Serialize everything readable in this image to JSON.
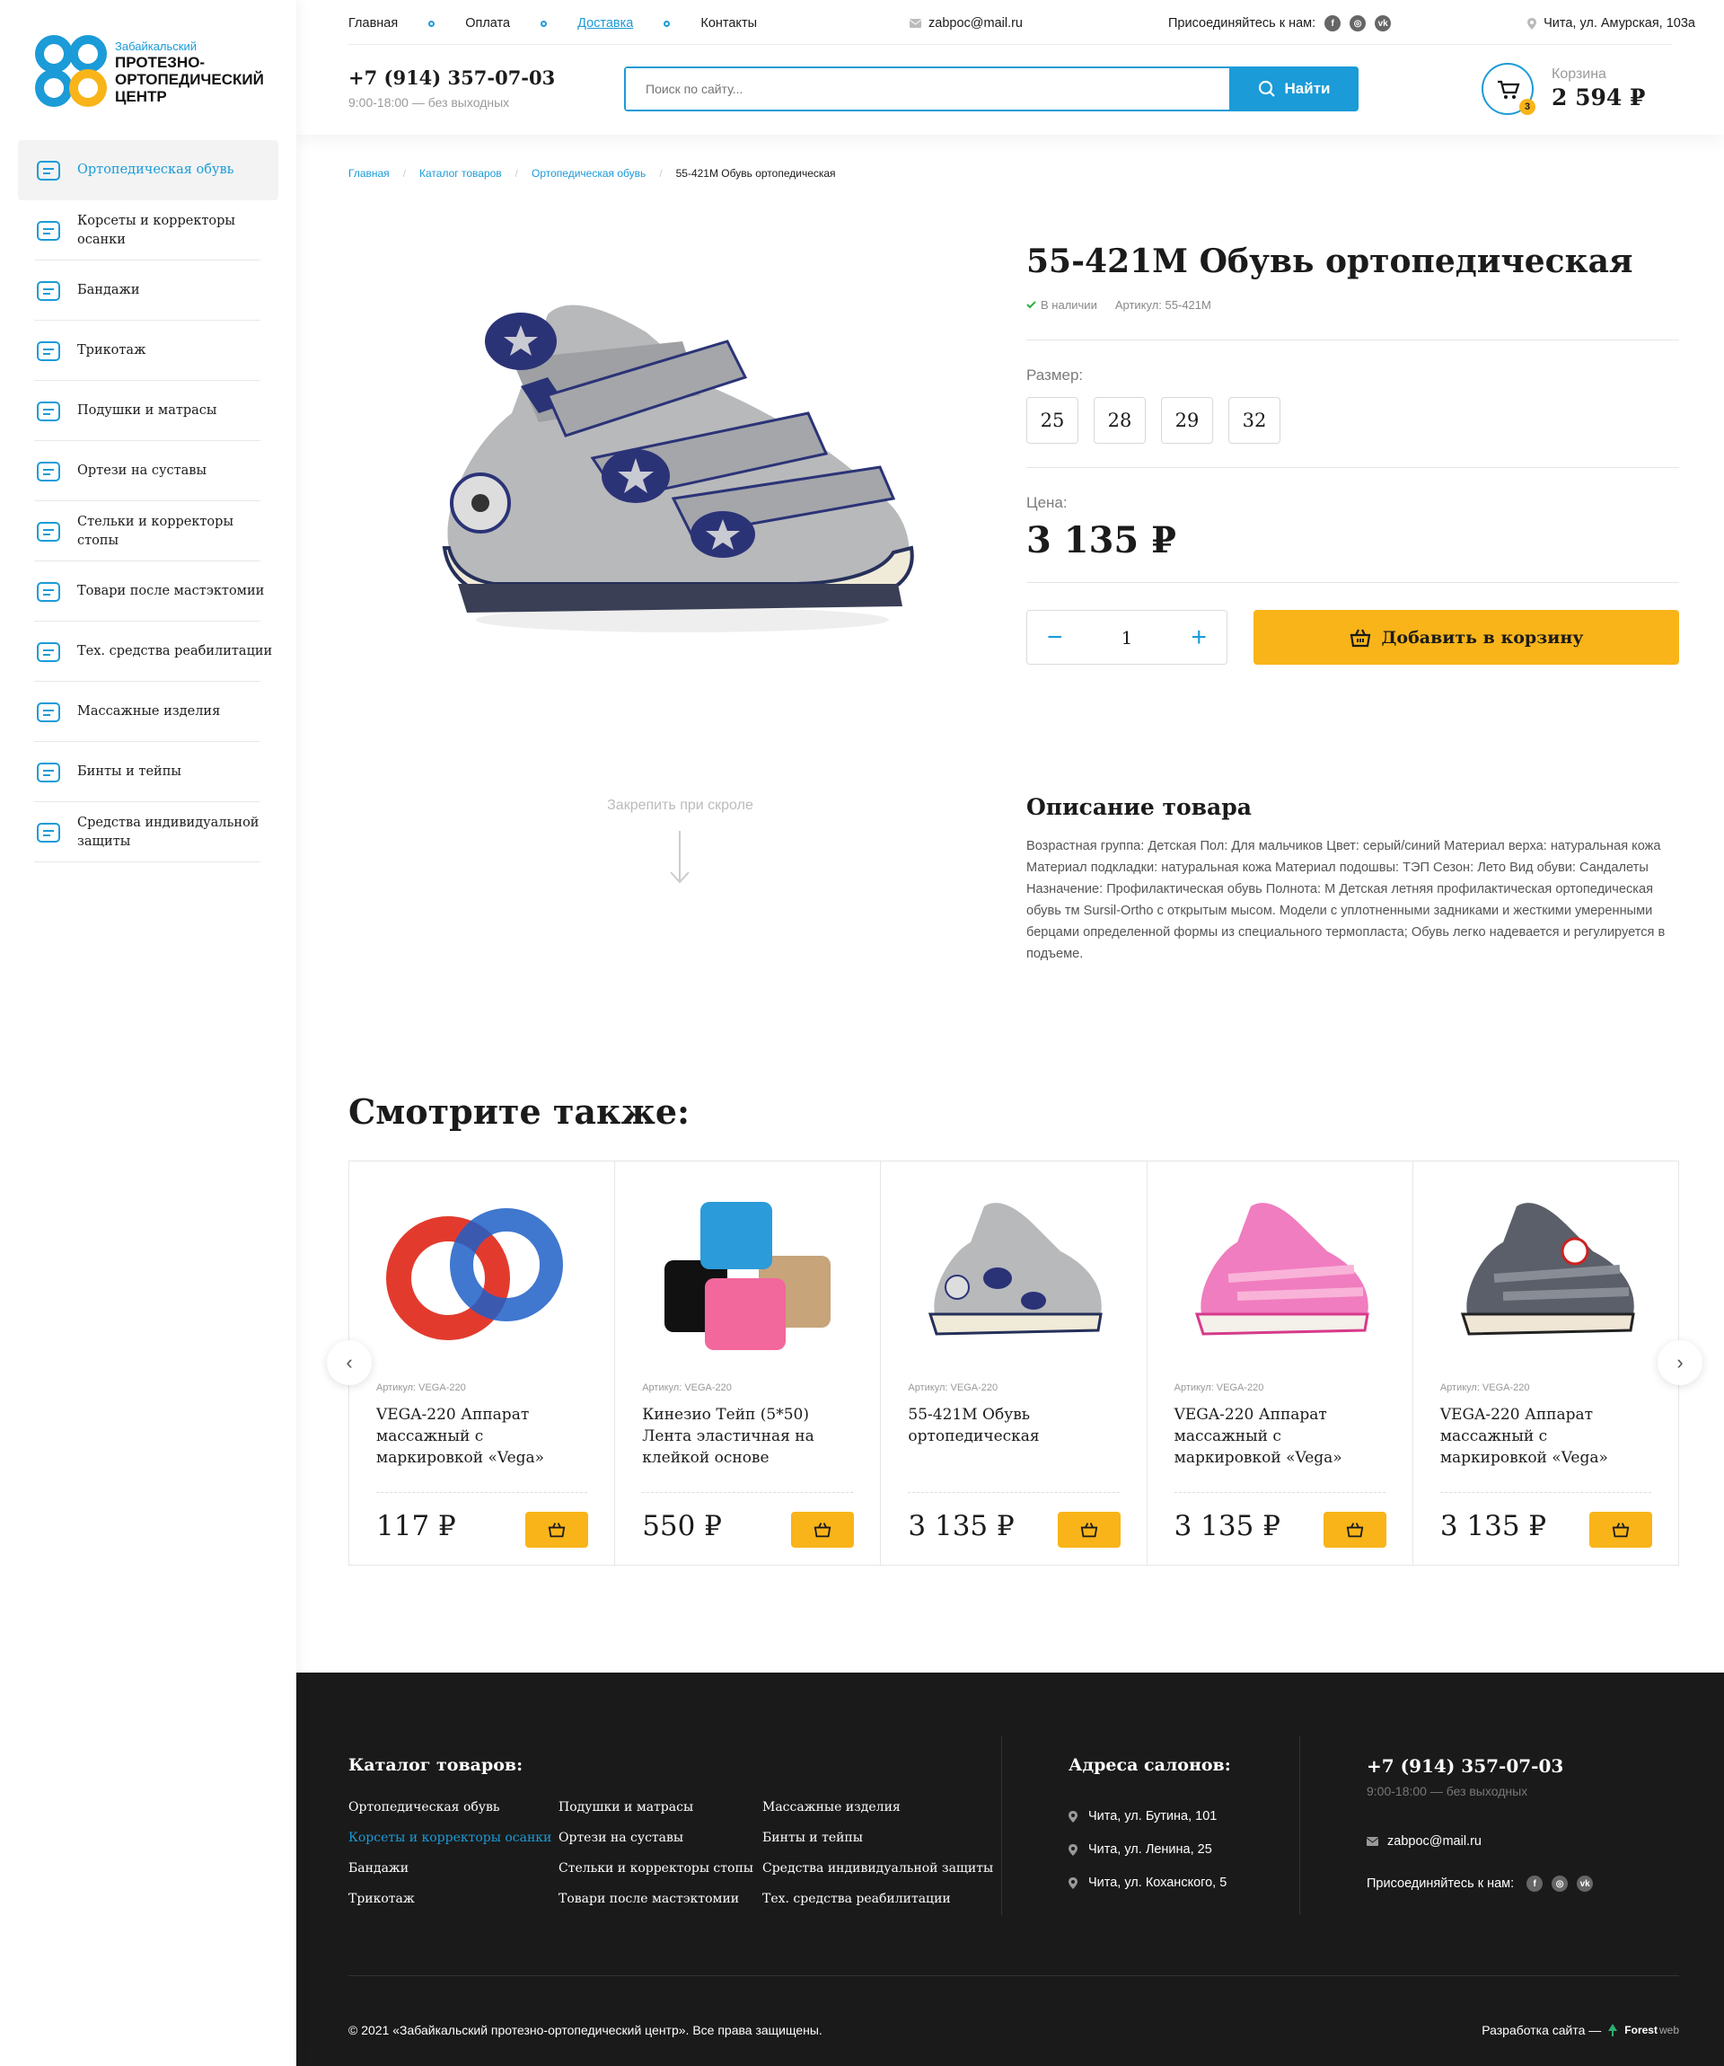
{
  "logo": {
    "line1": "Забайкальский",
    "line2": "ПРОТЕЗНО-ОРТОПЕДИЧЕСКИЙ ЦЕНТР"
  },
  "sidebar": {
    "items": [
      {
        "label": "Ортопедическая обувь",
        "icon": "shoe-icon"
      },
      {
        "label": "Корсеты и корректоры осанки",
        "icon": "corset-icon"
      },
      {
        "label": "Бандажи",
        "icon": "bandage-icon"
      },
      {
        "label": "Трикотаж",
        "icon": "knitwear-icon"
      },
      {
        "label": "Подушки и матрасы",
        "icon": "pillow-icon"
      },
      {
        "label": "Ортези на суставы",
        "icon": "orthosis-icon"
      },
      {
        "label": "Стельки и корректоры стопы",
        "icon": "insole-icon"
      },
      {
        "label": "Товари после мастэктомии",
        "icon": "bra-icon"
      },
      {
        "label": "Тех. средства реабилитации",
        "icon": "crutches-icon"
      },
      {
        "label": "Массажные изделия",
        "icon": "massage-icon"
      },
      {
        "label": "Бинты и тейпы",
        "icon": "tape-icon"
      },
      {
        "label": "Средства индивидуальной защиты",
        "icon": "mask-icon"
      }
    ]
  },
  "topnav": {
    "links": [
      "Главная",
      "Оплата",
      "Доставка",
      "Контакты"
    ],
    "email": "zabpoc@mail.ru",
    "social_label": "Присоединяйтесь к нам:",
    "address": "Чита, ул. Амурская, 103а"
  },
  "header": {
    "phone": "+7 (914) 357-07-03",
    "hours": "9:00-18:00 — без выходных",
    "search_placeholder": "Поиск по сайту...",
    "search_button": "Найти",
    "cart_label": "Корзина",
    "cart_sum": "2 594 ₽",
    "cart_count": "3"
  },
  "breadcrumbs": [
    "Главная",
    "Каталог товаров",
    "Ортопедическая обувь",
    "55-421M Обувь ортопедическая"
  ],
  "product": {
    "title": "55-421M Обувь ортопедическая",
    "stock": "В наличии",
    "article": "Артикул: 55-421M",
    "size_label": "Размер:",
    "sizes": [
      "25",
      "28",
      "29",
      "32"
    ],
    "price_label": "Цена:",
    "price": "3 135 ₽",
    "qty": "1",
    "add_button": "Добавить в корзину"
  },
  "pin": {
    "label": "Закрепить при скроле"
  },
  "description": {
    "title": "Описание товара",
    "text": "Возрастная группа: Детская Пол: Для мальчиков Цвет: серый/синий Материал верха: натуральная кожа Материал подкладки: натуральная кожа Материал подошвы: ТЭП Сезон: Лето Вид обуви: Сандалеты Назначение: Профилактическая обувь Полнота: М Детская летняя профилактическая ортопедическая обувь тм Sursil-Ortho с открытым мысом. Модели с уплотненными задниками и жесткими умеренными берцами определенной формы из специального термопласта; Обувь легко надевается и регулируется в подъеме."
  },
  "related": {
    "title": "Смотрите также:",
    "items": [
      {
        "article": "Артикул: VEGA-220",
        "name": "VEGA-220 Аппарат массажный с маркировкой «Vega»",
        "price": "117 ₽"
      },
      {
        "article": "Артикул: VEGA-220",
        "name": "Кинезио Тейп (5*50) Лента эластичная на клейкой основе",
        "price": "550 ₽"
      },
      {
        "article": "Артикул: VEGA-220",
        "name": "55-421M Обувь ортопедическая",
        "price": "3 135 ₽"
      },
      {
        "article": "Артикул: VEGA-220",
        "name": "VEGA-220 Аппарат массажный с маркировкой «Vega»",
        "price": "3 135 ₽"
      },
      {
        "article": "Артикул: VEGA-220",
        "name": "VEGA-220 Аппарат массажный с маркировкой «Vega»",
        "price": "3 135 ₽"
      }
    ]
  },
  "footer": {
    "catalog_title": "Каталог товаров:",
    "col1": [
      "Ортопедическая обувь",
      "Корсеты и корректоры осанки",
      "Бандажи",
      "Трикотаж"
    ],
    "col2": [
      "Подушки и матрасы",
      "Ортези на суставы",
      "Стельки и корректоры стопы",
      "Товари после мастэктомии"
    ],
    "col3": [
      "Массажные изделия",
      "Бинты и тейпы",
      "Средства индивидуальной  защиты",
      "Тех. средства реабилитации"
    ],
    "addr_title": "Адреса салонов:",
    "addresses": [
      "Чита, ул. Бутина, 101",
      "Чита, ул. Ленина, 25",
      "Чита, ул. Коханского, 5"
    ],
    "phone": "+7 (914) 357-07-03",
    "hours": "9:00-18:00 — без выходных",
    "email": "zabpoc@mail.ru",
    "social_label": "Присоединяйтесь к нам:",
    "copyright": "© 2021 «Забайкальский протезно-ортопедический центр». Все права защищены.",
    "dev_label": "Разработка сайта —",
    "dev_brand": "Forest",
    "dev_brand2": "web"
  },
  "colors": {
    "accent": "#1b9bd7",
    "yellow": "#f9b419",
    "footer_bg": "#1a1a1a"
  }
}
